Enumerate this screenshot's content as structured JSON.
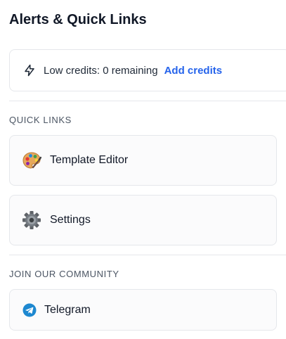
{
  "page": {
    "title": "Alerts & Quick Links"
  },
  "alert": {
    "icon": "lightning-bolt-icon",
    "text": "Low credits: 0 remaining",
    "link_label": "Add credits",
    "link_color": "#2563eb"
  },
  "quick_links": {
    "heading": "QUICK LINKS",
    "items": [
      {
        "label": "Template Editor",
        "icon": "palette-icon"
      },
      {
        "label": "Settings",
        "icon": "gear-icon"
      }
    ]
  },
  "community": {
    "heading": "JOIN OUR COMMUNITY",
    "items": [
      {
        "label": "Telegram",
        "icon": "telegram-icon",
        "color": "#1e88d0"
      }
    ]
  }
}
